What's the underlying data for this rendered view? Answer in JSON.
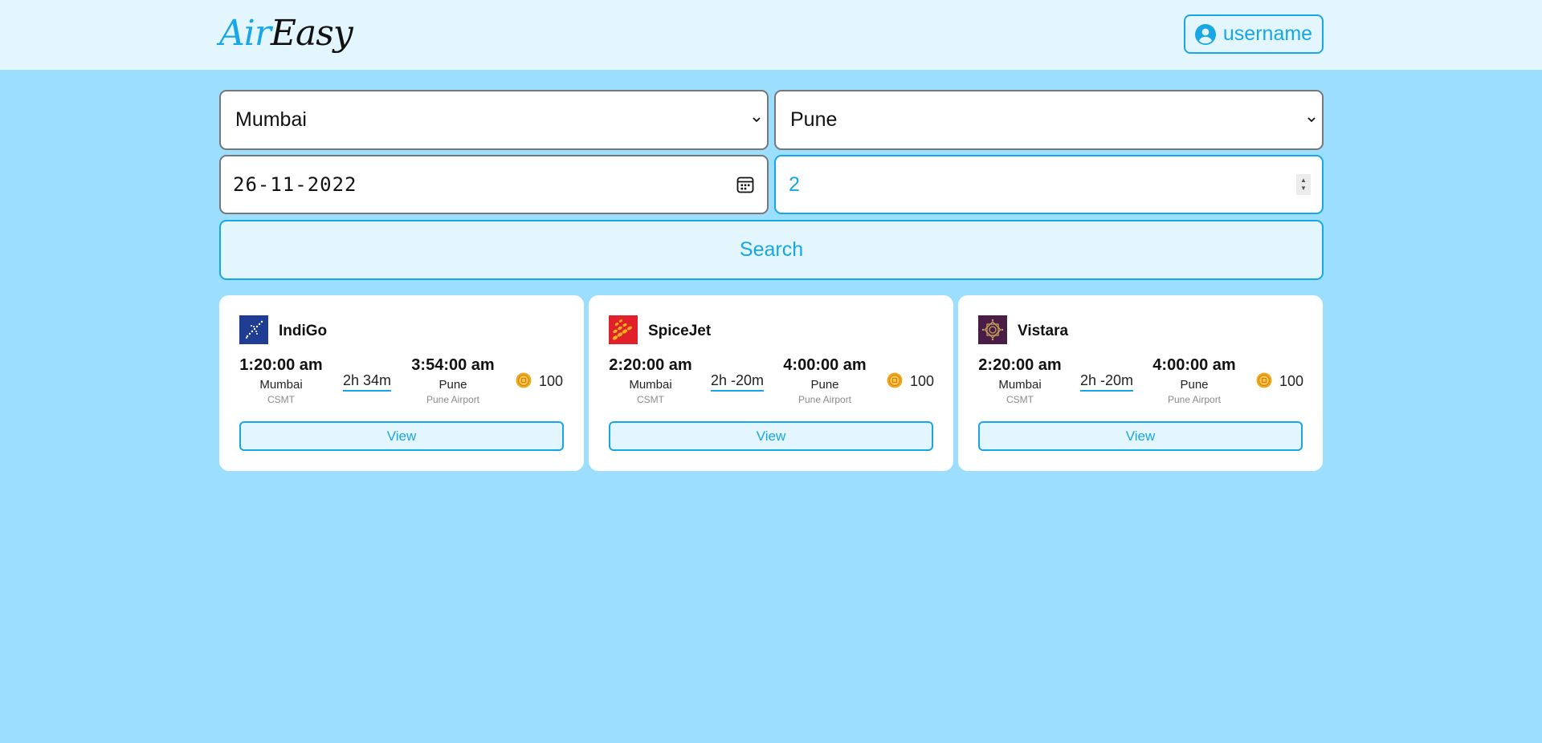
{
  "header": {
    "logo_part1": "Air",
    "logo_part2": "Easy",
    "user_label": "username",
    "user_icon": "user-circle-icon"
  },
  "search": {
    "from_value": "Mumbai",
    "to_value": "Pune",
    "date_value": "26-11-2022",
    "passengers_value": "2",
    "search_label": "Search"
  },
  "flights": [
    {
      "airline": "IndiGo",
      "logo_icon": "indigo-logo-icon",
      "logo_color": "#1f3d93",
      "depart_time": "1:20:00 am",
      "depart_city": "Mumbai",
      "depart_airport": "CSMT",
      "duration": "2h 34m",
      "arrive_time": "3:54:00 am",
      "arrive_city": "Pune",
      "arrive_airport": "Pune Airport",
      "price": "100",
      "view_label": "View"
    },
    {
      "airline": "SpiceJet",
      "logo_icon": "spicejet-logo-icon",
      "logo_color": "#e0202a",
      "depart_time": "2:20:00 am",
      "depart_city": "Mumbai",
      "depart_airport": "CSMT",
      "duration": "2h -20m",
      "arrive_time": "4:00:00 am",
      "arrive_city": "Pune",
      "arrive_airport": "Pune Airport",
      "price": "100",
      "view_label": "View"
    },
    {
      "airline": "Vistara",
      "logo_icon": "vistara-logo-icon",
      "logo_color": "#4a1d47",
      "depart_time": "2:20:00 am",
      "depart_city": "Mumbai",
      "depart_airport": "CSMT",
      "duration": "2h -20m",
      "arrive_time": "4:00:00 am",
      "arrive_city": "Pune",
      "arrive_airport": "Pune Airport",
      "price": "100",
      "view_label": "View"
    }
  ],
  "colors": {
    "accent": "#17a6e6",
    "page_background": "#9bdefd",
    "header_background": "#e3f5fd",
    "coin": "#f0a91c"
  }
}
